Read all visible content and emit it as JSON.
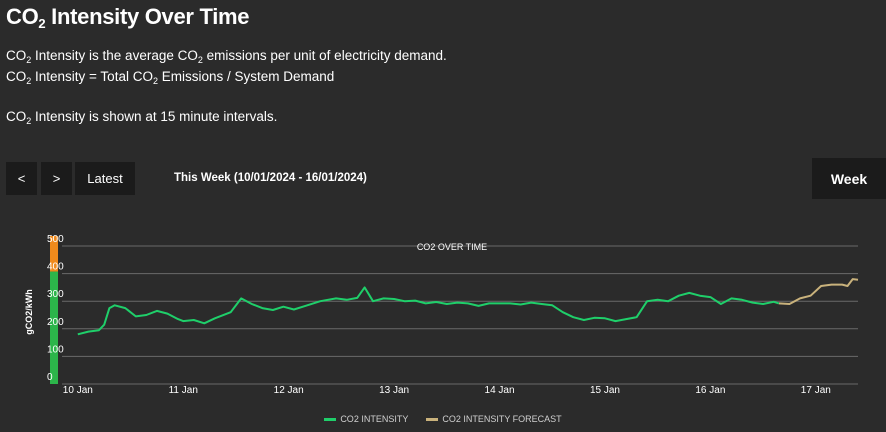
{
  "header": {
    "title_main": "CO",
    "title_sub": "2",
    "title_rest": " Intensity Over Time"
  },
  "description": {
    "line1_a": "CO",
    "line1_b": " Intensity is the average CO",
    "line1_c": " emissions per unit of electricity demand.",
    "line2_a": "CO",
    "line2_b": " Intensity = Total CO",
    "line2_c": " Emissions / System Demand",
    "line3_a": "CO",
    "line3_b": " Intensity is shown at 15 minute intervals.",
    "sub": "2"
  },
  "controls": {
    "prev_label": "<",
    "next_label": ">",
    "latest_label": "Latest",
    "range_label": "This Week (10/01/2024 - 16/01/2024)",
    "week_label": "Week"
  },
  "colors": {
    "background": "#2b2b2b",
    "actual": "#1fcf6a",
    "forecast": "#c9b27c",
    "band_green": "#2cb54a",
    "band_orange": "#f08a1c",
    "grid": "#6a6a6a"
  },
  "chart_data": {
    "type": "line",
    "title": "CO2 OVER TIME",
    "xlabel": "",
    "ylabel": "gCO2/kWh",
    "ylim": [
      0,
      500
    ],
    "yticks": [
      0,
      100,
      200,
      300,
      400,
      500
    ],
    "x_tick_labels": [
      "10 Jan",
      "11 Jan",
      "12 Jan",
      "13 Jan",
      "14 Jan",
      "15 Jan",
      "16 Jan",
      "17 Jan"
    ],
    "x_unit": "days since 10 Jan 00:00",
    "x_tick_values": [
      0,
      1,
      2,
      3,
      4,
      5,
      6,
      7
    ],
    "xlim": [
      -0.15,
      7.4
    ],
    "grid": true,
    "legend_position": "bottom",
    "color_band": {
      "green_below": 400,
      "orange_above": 400
    },
    "series": [
      {
        "name": "CO2 INTENSITY",
        "points": [
          [
            0.0,
            180
          ],
          [
            0.1,
            190
          ],
          [
            0.2,
            195
          ],
          [
            0.25,
            215
          ],
          [
            0.3,
            275
          ],
          [
            0.35,
            285
          ],
          [
            0.45,
            275
          ],
          [
            0.55,
            245
          ],
          [
            0.65,
            250
          ],
          [
            0.75,
            265
          ],
          [
            0.85,
            255
          ],
          [
            0.95,
            235
          ],
          [
            1.0,
            228
          ],
          [
            1.1,
            232
          ],
          [
            1.2,
            220
          ],
          [
            1.3,
            238
          ],
          [
            1.45,
            260
          ],
          [
            1.55,
            310
          ],
          [
            1.65,
            290
          ],
          [
            1.75,
            275
          ],
          [
            1.85,
            268
          ],
          [
            1.95,
            280
          ],
          [
            2.05,
            270
          ],
          [
            2.15,
            282
          ],
          [
            2.3,
            300
          ],
          [
            2.45,
            310
          ],
          [
            2.55,
            305
          ],
          [
            2.65,
            312
          ],
          [
            2.72,
            350
          ],
          [
            2.8,
            300
          ],
          [
            2.9,
            310
          ],
          [
            3.0,
            308
          ],
          [
            3.1,
            300
          ],
          [
            3.2,
            302
          ],
          [
            3.3,
            292
          ],
          [
            3.4,
            297
          ],
          [
            3.5,
            290
          ],
          [
            3.6,
            295
          ],
          [
            3.7,
            292
          ],
          [
            3.8,
            283
          ],
          [
            3.9,
            292
          ],
          [
            4.0,
            292
          ],
          [
            4.1,
            292
          ],
          [
            4.2,
            288
          ],
          [
            4.3,
            295
          ],
          [
            4.4,
            290
          ],
          [
            4.5,
            285
          ],
          [
            4.6,
            260
          ],
          [
            4.7,
            242
          ],
          [
            4.8,
            232
          ],
          [
            4.9,
            240
          ],
          [
            5.0,
            238
          ],
          [
            5.1,
            228
          ],
          [
            5.2,
            235
          ],
          [
            5.3,
            242
          ],
          [
            5.4,
            300
          ],
          [
            5.5,
            305
          ],
          [
            5.6,
            300
          ],
          [
            5.7,
            320
          ],
          [
            5.8,
            330
          ],
          [
            5.9,
            320
          ],
          [
            6.0,
            315
          ],
          [
            6.1,
            290
          ],
          [
            6.2,
            310
          ],
          [
            6.3,
            305
          ],
          [
            6.4,
            295
          ],
          [
            6.5,
            290
          ],
          [
            6.6,
            298
          ],
          [
            6.65,
            292
          ]
        ]
      },
      {
        "name": "CO2 INTENSITY FORECAST",
        "points": [
          [
            6.65,
            292
          ],
          [
            6.75,
            290
          ],
          [
            6.85,
            310
          ],
          [
            6.95,
            320
          ],
          [
            7.05,
            355
          ],
          [
            7.15,
            360
          ],
          [
            7.25,
            360
          ],
          [
            7.3,
            355
          ],
          [
            7.35,
            380
          ],
          [
            7.4,
            378
          ]
        ]
      }
    ]
  }
}
